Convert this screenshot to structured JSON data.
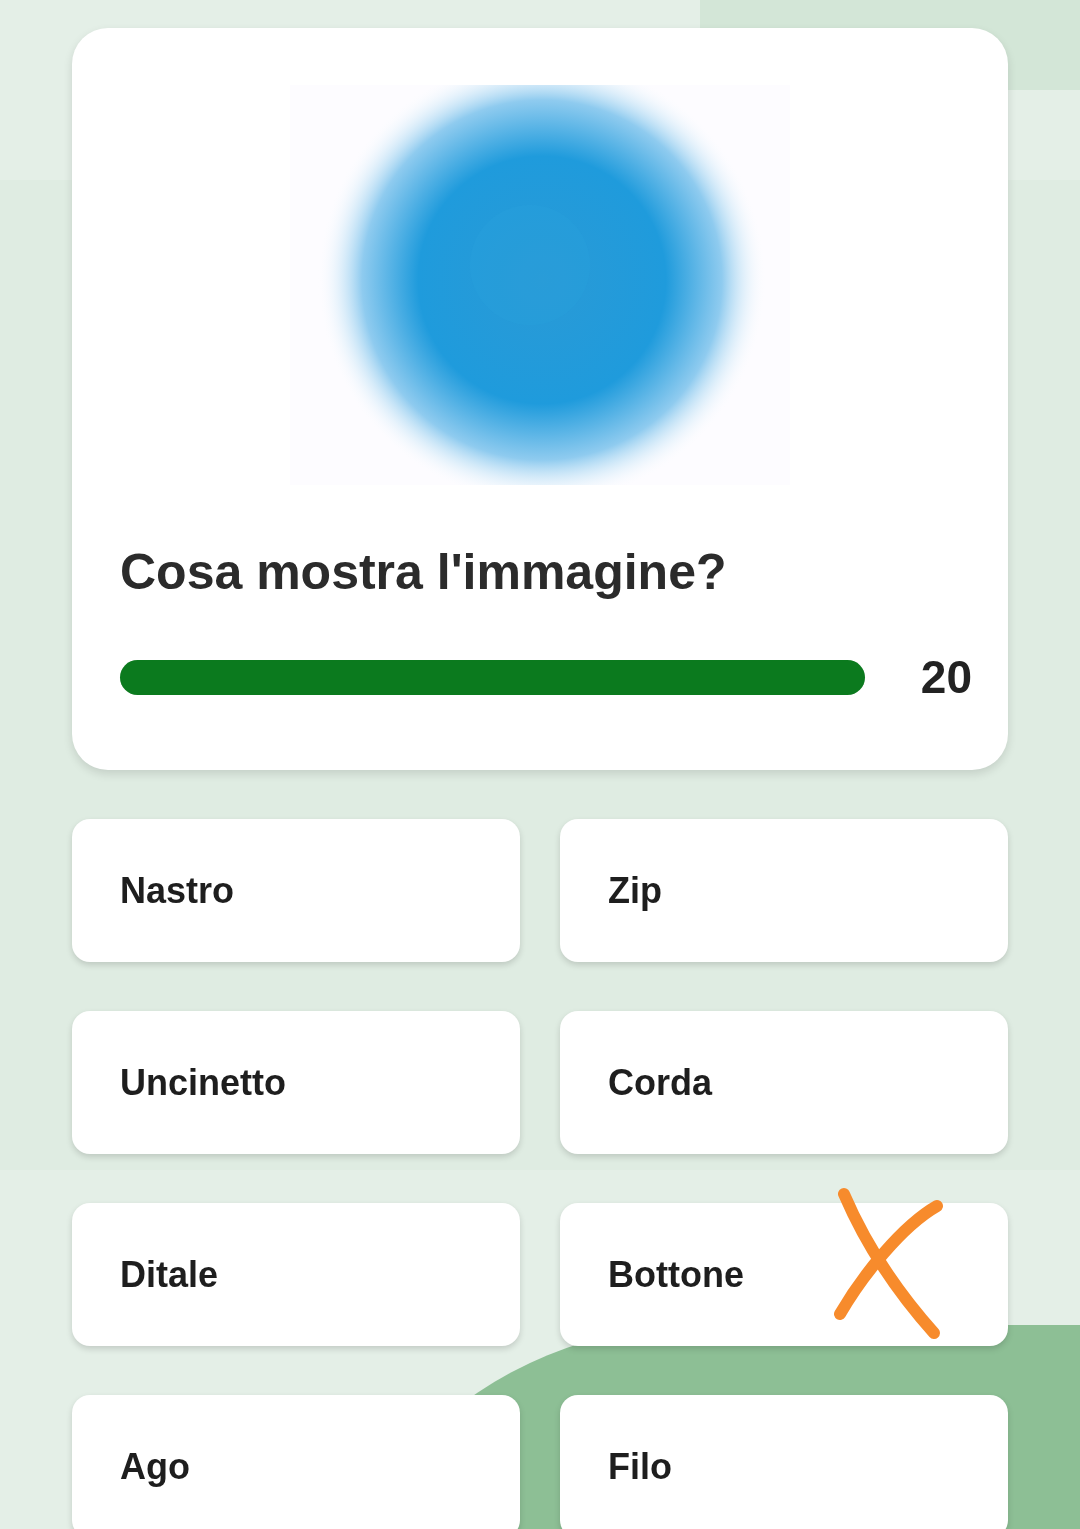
{
  "question": {
    "text": "Cosa mostra l'immagine?",
    "timer": {
      "level": 1.0,
      "reading": "20"
    }
  },
  "options": [
    {
      "label": "Nastro",
      "marked": false
    },
    {
      "label": "Zip",
      "marked": false
    },
    {
      "label": "Uncinetto",
      "marked": false
    },
    {
      "label": "Corda",
      "marked": false
    },
    {
      "label": "Ditale",
      "marked": false
    },
    {
      "label": "Bottone",
      "marked": true
    },
    {
      "label": "Ago",
      "marked": false
    },
    {
      "label": "Filo",
      "marked": false
    }
  ]
}
